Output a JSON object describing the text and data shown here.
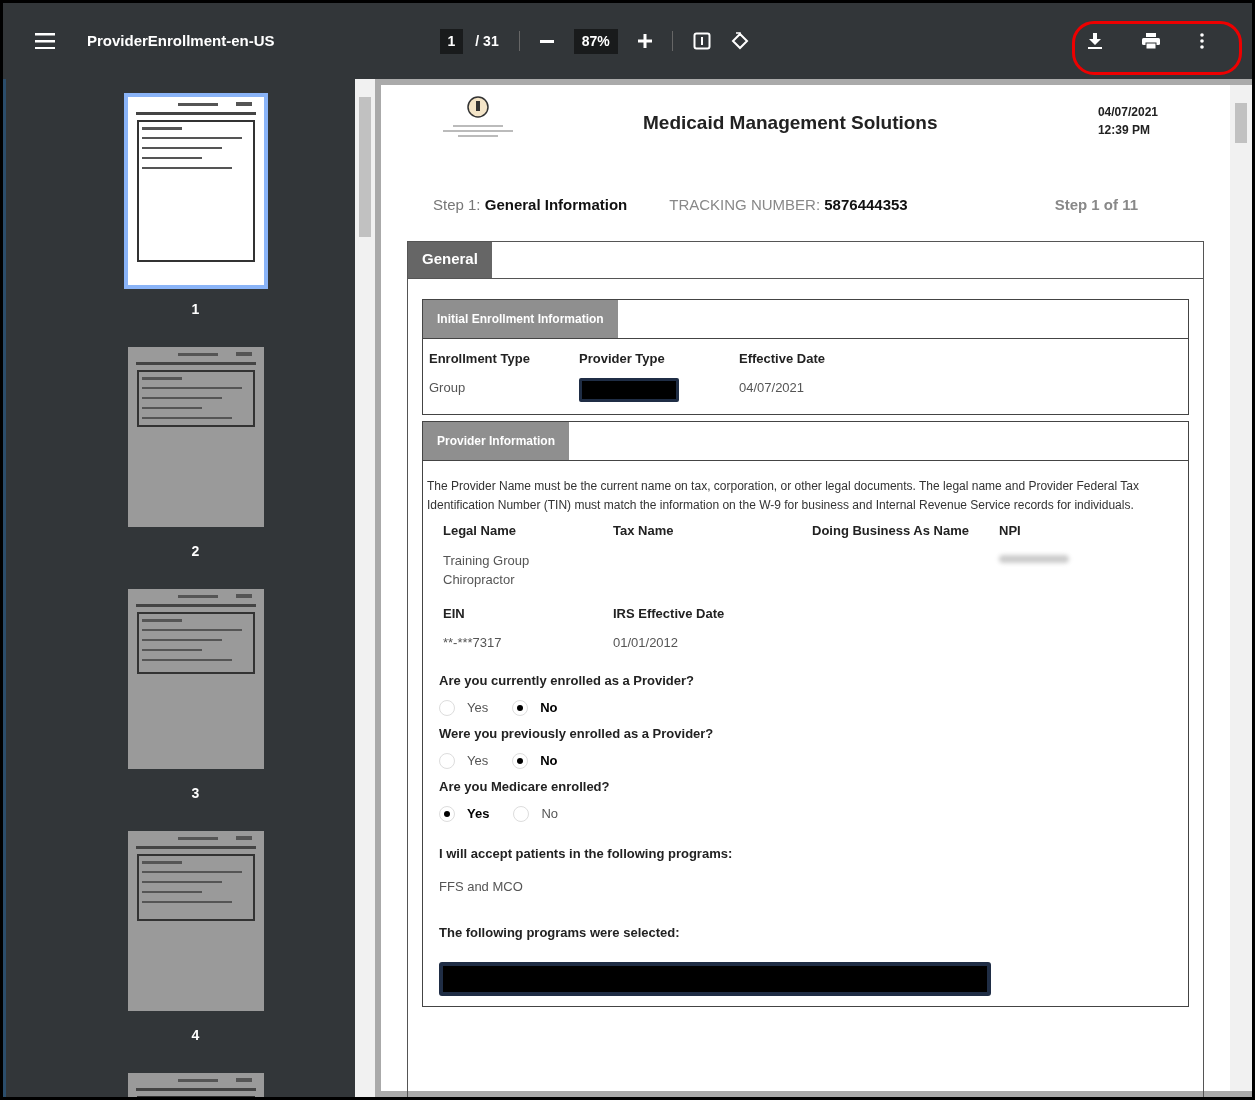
{
  "toolbar": {
    "title": "ProviderEnrollment-en-US",
    "page_current": "1",
    "page_total": "/ 31",
    "zoom": "87%"
  },
  "thumbnails": [
    {
      "label": "1",
      "selected": true
    },
    {
      "label": "2",
      "selected": false
    },
    {
      "label": "3",
      "selected": false
    },
    {
      "label": "4",
      "selected": false
    },
    {
      "selected": false
    }
  ],
  "document": {
    "header_title": "Medicaid Management Solutions",
    "date": "04/07/2021",
    "time": "12:39 PM",
    "step_label": "Step 1:",
    "step_name": "General Information",
    "tracking_label": "TRACKING NUMBER:",
    "tracking_number": "5876444353",
    "step_count": "Step 1 of 11",
    "section_tab": "General",
    "initial_panel": {
      "title": "Initial Enrollment Information",
      "fields": [
        {
          "label": "Enrollment Type",
          "kind": "text",
          "value": "Group"
        },
        {
          "label": "Provider Type",
          "kind": "redacted"
        },
        {
          "label": "Effective Date",
          "kind": "text",
          "value": "04/07/2021"
        }
      ]
    },
    "provider_panel": {
      "title": "Provider Information",
      "note": "The Provider Name must be the current name on tax, corporation, or other legal documents. The legal name and Provider Federal Tax Identification Number (TIN) must match the information on the W-9 for business and Internal Revenue Service records for individuals.",
      "fields": [
        {
          "label": "Legal Name",
          "kind": "text",
          "value": "Training Group Chiropractor"
        },
        {
          "label": "Tax Name",
          "kind": "empty"
        },
        {
          "label": "Doing Business As Name",
          "kind": "empty"
        },
        {
          "label": "NPI",
          "kind": "blurred"
        },
        {
          "label": "EIN",
          "kind": "text",
          "value": "**-***7317"
        },
        {
          "label": "IRS Effective Date",
          "kind": "text",
          "value": "01/01/2012"
        }
      ],
      "questions": [
        {
          "question": "Are you currently enrolled as a Provider?",
          "options": [
            {
              "label": "Yes",
              "selected": false
            },
            {
              "label": "No",
              "selected": true
            }
          ]
        },
        {
          "question": "Were you previously enrolled as a Provider?",
          "options": [
            {
              "label": "Yes",
              "selected": false
            },
            {
              "label": "No",
              "selected": true
            }
          ]
        },
        {
          "question": "Are you Medicare enrolled?",
          "options": [
            {
              "label": "Yes",
              "selected": true
            },
            {
              "label": "No",
              "selected": false
            }
          ]
        }
      ],
      "programs_label": "I will accept patients in the following programs:",
      "programs_value": "FFS and MCO",
      "selected_label": "The following programs were selected:"
    }
  }
}
